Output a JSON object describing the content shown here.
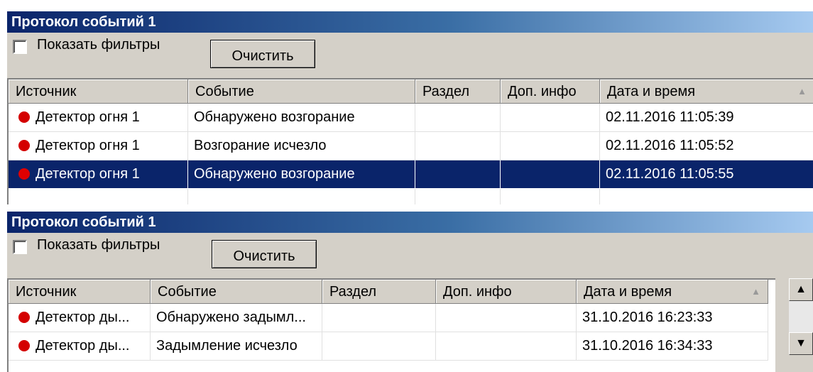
{
  "windows": [
    {
      "title": "Протокол событий 1",
      "show_filters_label": "Показать фильтры",
      "clear_label": "Очистить",
      "columns": [
        "Источник",
        "Событие",
        "Раздел",
        "Доп. инфо",
        "Дата и время"
      ],
      "sort_indicator": "▲",
      "rows": [
        {
          "source": "Детектор огня 1",
          "event": "Обнаружено возгорание",
          "section": "",
          "info": "",
          "datetime": "02.11.2016 11:05:39",
          "selected": false
        },
        {
          "source": "Детектор огня 1",
          "event": "Возгорание исчезло",
          "section": "",
          "info": "",
          "datetime": "02.11.2016 11:05:52",
          "selected": false
        },
        {
          "source": "Детектор огня 1",
          "event": "Обнаружено возгорание",
          "section": "",
          "info": "",
          "datetime": "02.11.2016 11:05:55",
          "selected": true
        }
      ]
    },
    {
      "title": "Протокол событий 1",
      "show_filters_label": "Показать фильтры",
      "clear_label": "Очистить",
      "columns": [
        "Источник",
        "Событие",
        "Раздел",
        "Доп. инфо",
        "Дата и время"
      ],
      "sort_indicator": "▲",
      "rows": [
        {
          "source": "Детектор ды...",
          "event": "Обнаружено задымл...",
          "section": "",
          "info": "",
          "datetime": "31.10.2016 16:23:33",
          "selected": false
        },
        {
          "source": "Детектор ды...",
          "event": "Задымление исчезло",
          "section": "",
          "info": "",
          "datetime": "31.10.2016 16:34:33",
          "selected": false
        }
      ],
      "scrollbar": {
        "up": "▲",
        "down": "▼"
      }
    }
  ],
  "colors": {
    "title_start": "#0a246a",
    "title_end": "#a6caf0",
    "selection": "#0a246a",
    "status_dot": "#d40000",
    "face": "#d4d0c8"
  },
  "icons": {
    "status": "red-dot-icon",
    "checkbox": "checkbox-unchecked-icon",
    "sort": "sort-ascending-icon"
  }
}
